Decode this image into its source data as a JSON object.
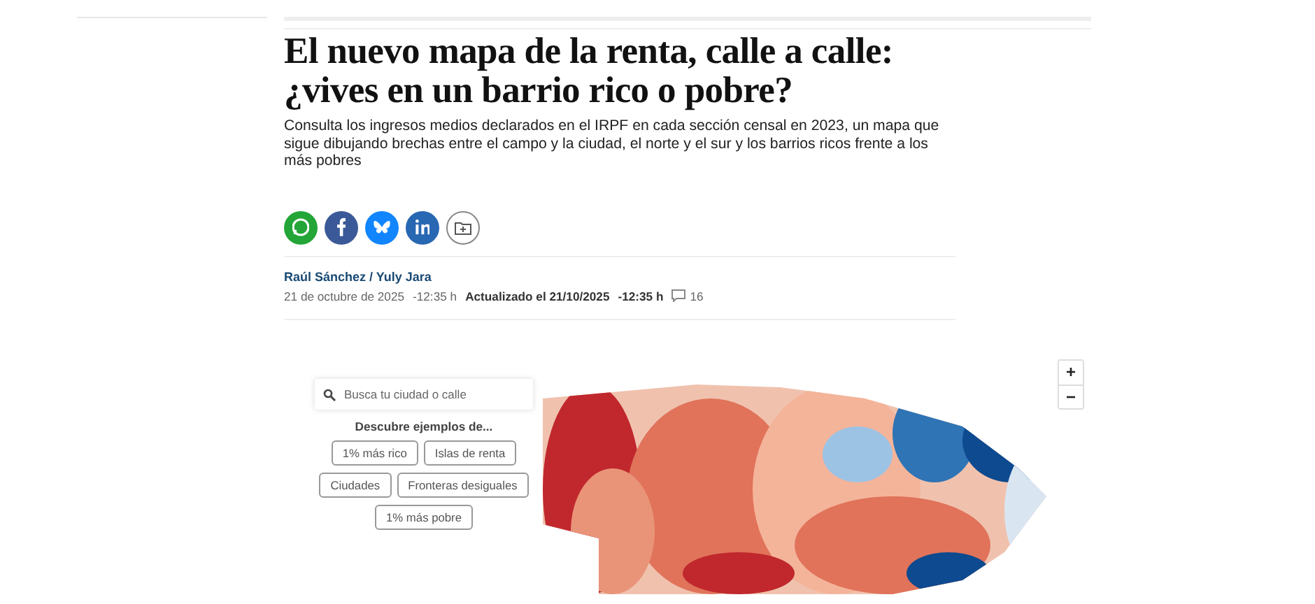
{
  "article": {
    "title": "El nuevo mapa de la renta, calle a calle: ¿vives en un barrio rico o pobre?",
    "subtitle": "Consulta los ingresos medios declarados en el IRPF en cada sección censal en 2023, un mapa que sigue dibujando brechas entre el campo y la ciudad, el norte y el sur y los barrios ricos frente a los más pobres",
    "share_buttons": [
      {
        "kind": "whatsapp"
      },
      {
        "kind": "facebook"
      },
      {
        "kind": "bluesky"
      },
      {
        "kind": "linkedin"
      },
      {
        "kind": "save"
      }
    ],
    "authors": "Raúl Sánchez / Yuly Jara",
    "date": "21 de octubre de 2025",
    "time": "-12:35 h",
    "updated": "Actualizado el 21/10/2025",
    "updated_time": "-12:35 h",
    "comments": "16"
  },
  "map": {
    "search": {
      "placeholder": "Busca tu ciudad o calle"
    },
    "examples_title": "Descubre ejemplos de...",
    "examples": [
      [
        "1% más rico",
        "Islas de renta"
      ],
      [
        "Ciudades",
        "Fronteras desiguales"
      ],
      [
        "1% más pobre"
      ]
    ],
    "zoom": [
      "+",
      "−"
    ]
  }
}
